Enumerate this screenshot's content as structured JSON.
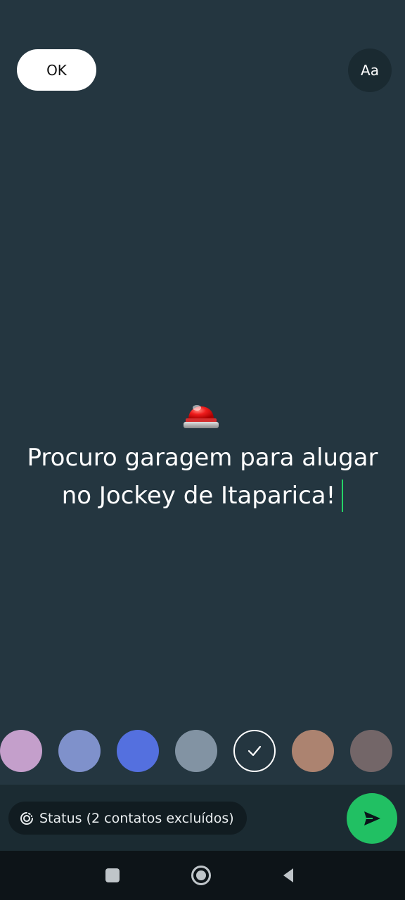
{
  "header": {
    "ok_label": "OK",
    "font_label": "Aa"
  },
  "status": {
    "emoji": "🚨",
    "emoji_icon": "police-siren-icon",
    "text_line1": "Procuro garagem para alugar",
    "text_line2": "no Jockey de Itaparica!",
    "background_color": "#243640",
    "caret_color": "#25d366"
  },
  "palette": {
    "colors": [
      "#c49fcb",
      "#7f91cb",
      "#5470df",
      "#8293a3",
      "#243640",
      "#ac8370",
      "#736668"
    ],
    "selected_index": 4
  },
  "footer": {
    "audience_icon": "status-ring-icon",
    "audience_label": "Status (2 contatos excluídos)",
    "send_icon": "send-icon",
    "send_color": "#21c063"
  },
  "nav": {
    "icons": [
      "recents-square-icon",
      "home-circle-icon",
      "back-triangle-icon"
    ]
  }
}
